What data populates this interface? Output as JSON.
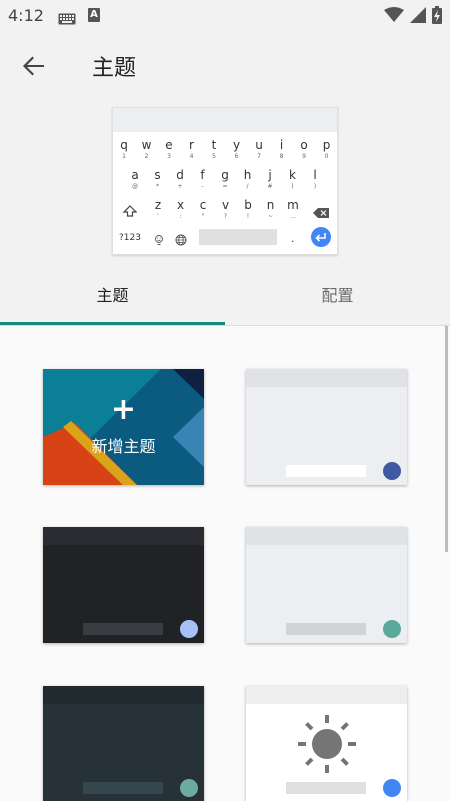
{
  "status": {
    "time": "4:12"
  },
  "appbar": {
    "title": "主题"
  },
  "keyboard_preview": {
    "rows": [
      [
        {
          "k": "q",
          "s": "1"
        },
        {
          "k": "w",
          "s": "2"
        },
        {
          "k": "e",
          "s": "3"
        },
        {
          "k": "r",
          "s": "4"
        },
        {
          "k": "t",
          "s": "5"
        },
        {
          "k": "y",
          "s": "6"
        },
        {
          "k": "u",
          "s": "7"
        },
        {
          "k": "i",
          "s": "8"
        },
        {
          "k": "o",
          "s": "9"
        },
        {
          "k": "p",
          "s": "0"
        }
      ],
      [
        {
          "k": "a",
          "s": "@"
        },
        {
          "k": "s",
          "s": "*"
        },
        {
          "k": "d",
          "s": "+"
        },
        {
          "k": "f",
          "s": "-"
        },
        {
          "k": "g",
          "s": "="
        },
        {
          "k": "h",
          "s": "/"
        },
        {
          "k": "j",
          "s": "#"
        },
        {
          "k": "k",
          "s": "("
        },
        {
          "k": "l",
          "s": ")"
        }
      ],
      [
        {
          "k": "z",
          "s": "'"
        },
        {
          "k": "x",
          "s": ":"
        },
        {
          "k": "c",
          "s": "\""
        },
        {
          "k": "v",
          "s": "?"
        },
        {
          "k": "b",
          "s": "!"
        },
        {
          "k": "n",
          "s": "~"
        },
        {
          "k": "m",
          "s": "…"
        }
      ]
    ],
    "numbers_key": "?123",
    "period_key": "."
  },
  "tabs": {
    "themes": "主题",
    "config": "配置"
  },
  "themes": {
    "new_theme_label": "新增主题",
    "plus": "+",
    "cards": [
      {
        "name": "light-indigo",
        "bg": "#eceef1",
        "header": "#e0e2e6",
        "bar": "#ffffff",
        "accent": "#3f5aa0"
      },
      {
        "name": "dark",
        "bg": "#212226",
        "header": "#2b2c31",
        "bar": "#3b3c41",
        "accent": "#a7c1f7"
      },
      {
        "name": "light-teal",
        "bg": "#eceff1",
        "header": "#dfe3e6",
        "bar": "#d0d4d7",
        "accent": "#5aa99c"
      },
      {
        "name": "dark-slate",
        "bg": "#263238",
        "header": "#222b30",
        "bar": "#37474f",
        "accent": "#6daa9f"
      },
      {
        "name": "material-light",
        "bg": "#ffffff",
        "header": "#eeeeee",
        "bar": "#e0e0e0",
        "accent": "#4285f4"
      }
    ]
  }
}
